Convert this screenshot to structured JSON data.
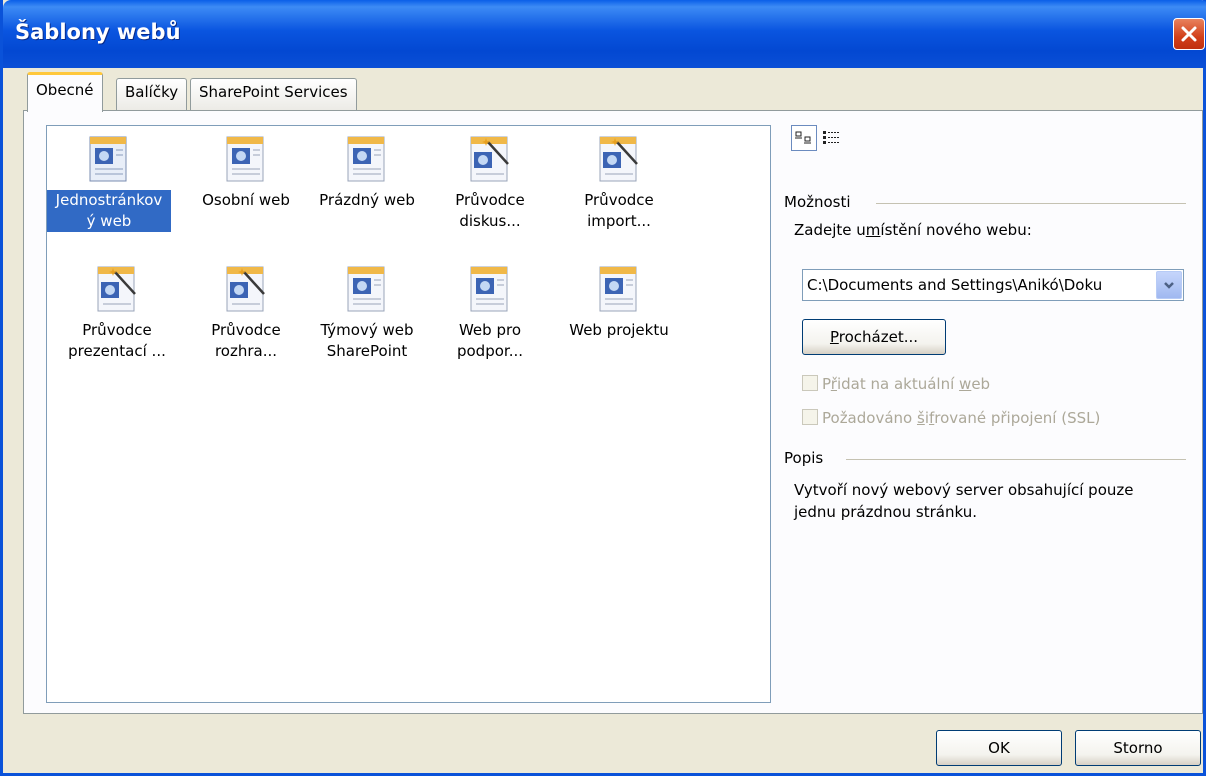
{
  "window": {
    "title": "Šablony webů"
  },
  "tabs": [
    {
      "label": "Obecné"
    },
    {
      "label": "Balíčky"
    },
    {
      "label": "SharePoint Services"
    }
  ],
  "templates": [
    {
      "line1": "Jednostránkov",
      "line2": "ý web",
      "icon": "web-page-icon",
      "selected": true
    },
    {
      "line1": "Osobní web",
      "line2": "",
      "icon": "web-page-icon"
    },
    {
      "line1": "Prázdný web",
      "line2": "",
      "icon": "web-page-icon"
    },
    {
      "line1": "Průvodce",
      "line2": "diskus...",
      "icon": "wizard-icon"
    },
    {
      "line1": "Průvodce",
      "line2": "import...",
      "icon": "wizard-icon"
    },
    {
      "line1": "Průvodce",
      "line2": "prezentací ...",
      "icon": "wizard-icon"
    },
    {
      "line1": "Průvodce",
      "line2": "rozhra...",
      "icon": "wizard-icon"
    },
    {
      "line1": "Týmový web",
      "line2": "SharePoint",
      "icon": "web-page-icon"
    },
    {
      "line1": "Web pro",
      "line2": "podpor...",
      "icon": "web-page-icon"
    },
    {
      "line1": "Web projektu",
      "line2": "",
      "icon": "web-page-icon"
    }
  ],
  "options": {
    "section_label": "Možnosti",
    "location_prompt_pre": "Zadejte u",
    "location_prompt_key": "m",
    "location_prompt_post": "ístění nového webu:",
    "location_value": "C:\\Documents and Settings\\Anikó\\Doku",
    "browse_key": "P",
    "browse_rest": "rocházet...",
    "add_current_pre": "P",
    "add_current_key": "ř",
    "add_current_post": "idat na aktuální ",
    "add_current_key2": "w",
    "add_current_post2": "eb",
    "ssl_pre": "Požadováno ",
    "ssl_key": "š",
    "ssl_mid": "i",
    "ssl_key2": "f",
    "ssl_post": "rované připojení (SSL)"
  },
  "description": {
    "section_label": "Popis",
    "line1": "Vytvoří nový webový server obsahující pouze",
    "line2": "jednu prázdnou stránku."
  },
  "buttons": {
    "ok": "OK",
    "cancel": "Storno"
  },
  "colors": {
    "titlebar": "#0a55e0",
    "selection": "#316ac5",
    "dialog_bg": "#ece9d8",
    "close": "#d2401a"
  }
}
